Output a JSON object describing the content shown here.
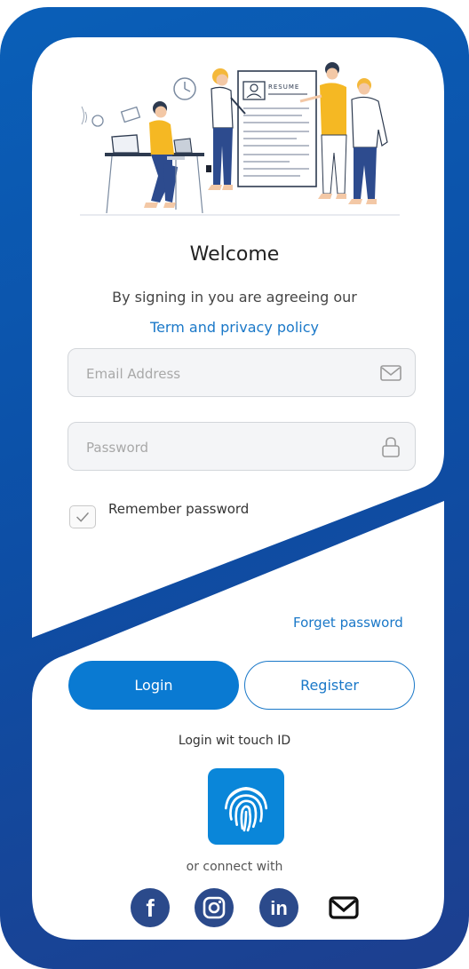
{
  "colors": {
    "brand_blue": "#0a5fb8",
    "accent_blue": "#1a78c8",
    "button_blue": "#0a7ad2",
    "fingerprint_tile": "#0a86d9",
    "social_navy": "#2b4a8b"
  },
  "hero": {
    "resume_label": "RESUME",
    "icon": "team-illustration"
  },
  "welcome": {
    "title": "Welcome",
    "agreement_text": "By signing in you are agreeing our",
    "terms_link": "Term and privacy policy"
  },
  "form": {
    "email": {
      "placeholder": "Email Address",
      "value": "",
      "icon": "envelope-icon"
    },
    "password": {
      "placeholder": "Password",
      "value": "",
      "icon": "lock-icon"
    },
    "remember": {
      "label": "Remember password",
      "checked": true
    },
    "forget_label": "Forget password"
  },
  "actions": {
    "login_label": "Login",
    "register_label": "Register"
  },
  "touch": {
    "label": "Login wit touch ID",
    "icon": "fingerprint-icon"
  },
  "social": {
    "label": "or connect with",
    "items": [
      {
        "name": "facebook",
        "glyph": "f"
      },
      {
        "name": "instagram",
        "icon": "instagram-icon"
      },
      {
        "name": "linkedin",
        "glyph": "in"
      },
      {
        "name": "email",
        "icon": "mail-icon"
      }
    ]
  }
}
